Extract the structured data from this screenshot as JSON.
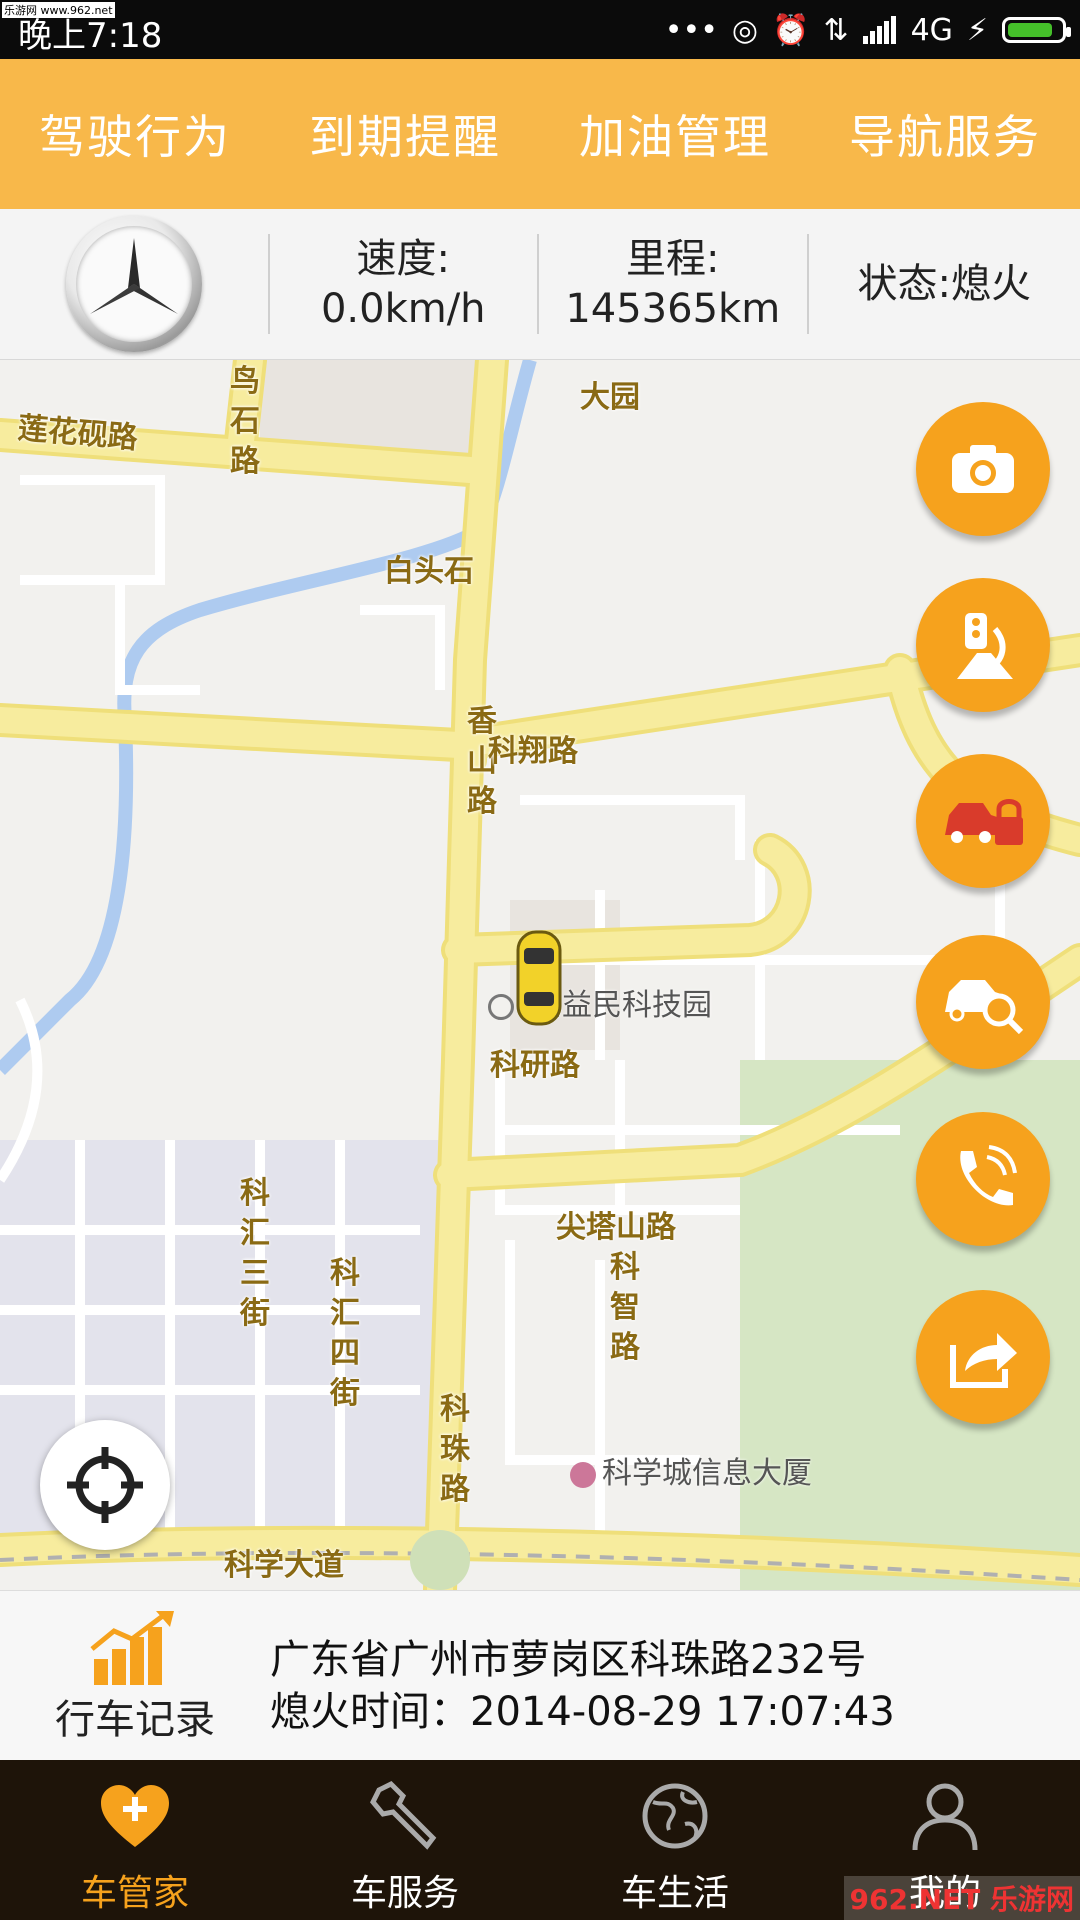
{
  "status_bar": {
    "watermark": "乐游网 www.962.net",
    "time": "晚上7:18",
    "network": "4G",
    "battery_level": 0.85
  },
  "top_nav": {
    "items": [
      "驾驶行为",
      "到期提醒",
      "加油管理",
      "导航服务"
    ]
  },
  "info_bar": {
    "speed_label": "速度:",
    "speed_value": "0.0km/h",
    "mileage_label": "里程:",
    "mileage_value": "145365km",
    "status": "状态:熄火"
  },
  "map": {
    "roads": {
      "lianhuayan": "莲花砚路",
      "kexiang": "科翔路",
      "keyan": "科研路",
      "jiantashan": "尖塔山路",
      "kexue": "科学大道",
      "xiangshan": "香山路",
      "kezhu": "科珠路",
      "kezhi": "科智路",
      "kehui3": "科汇三街",
      "kehui4": "科汇四街",
      "niaoshi": "鸟石路"
    },
    "places": {
      "dayuan": "大园",
      "baitoushi": "白头石",
      "yimin": "州益民科技园",
      "xinxi": "科学城信息大厦"
    }
  },
  "action_buttons": [
    "camera",
    "traffic",
    "car-lock",
    "car-search",
    "phone",
    "share"
  ],
  "record": {
    "label": "行车记录",
    "address": "广东省广州市萝岗区科珠路232号",
    "ignition_off_time": "熄火时间：2014-08-29 17:07:43"
  },
  "bottom_nav": {
    "tabs": [
      "车管家",
      "车服务",
      "车生活",
      "我的"
    ],
    "active_index": 0,
    "watermark": "962.NET 乐游网"
  },
  "colors": {
    "accent": "#f8b84a",
    "fab": "#f6a21d",
    "nav_bg": "#1e1409",
    "road": "#f7ec9e"
  }
}
